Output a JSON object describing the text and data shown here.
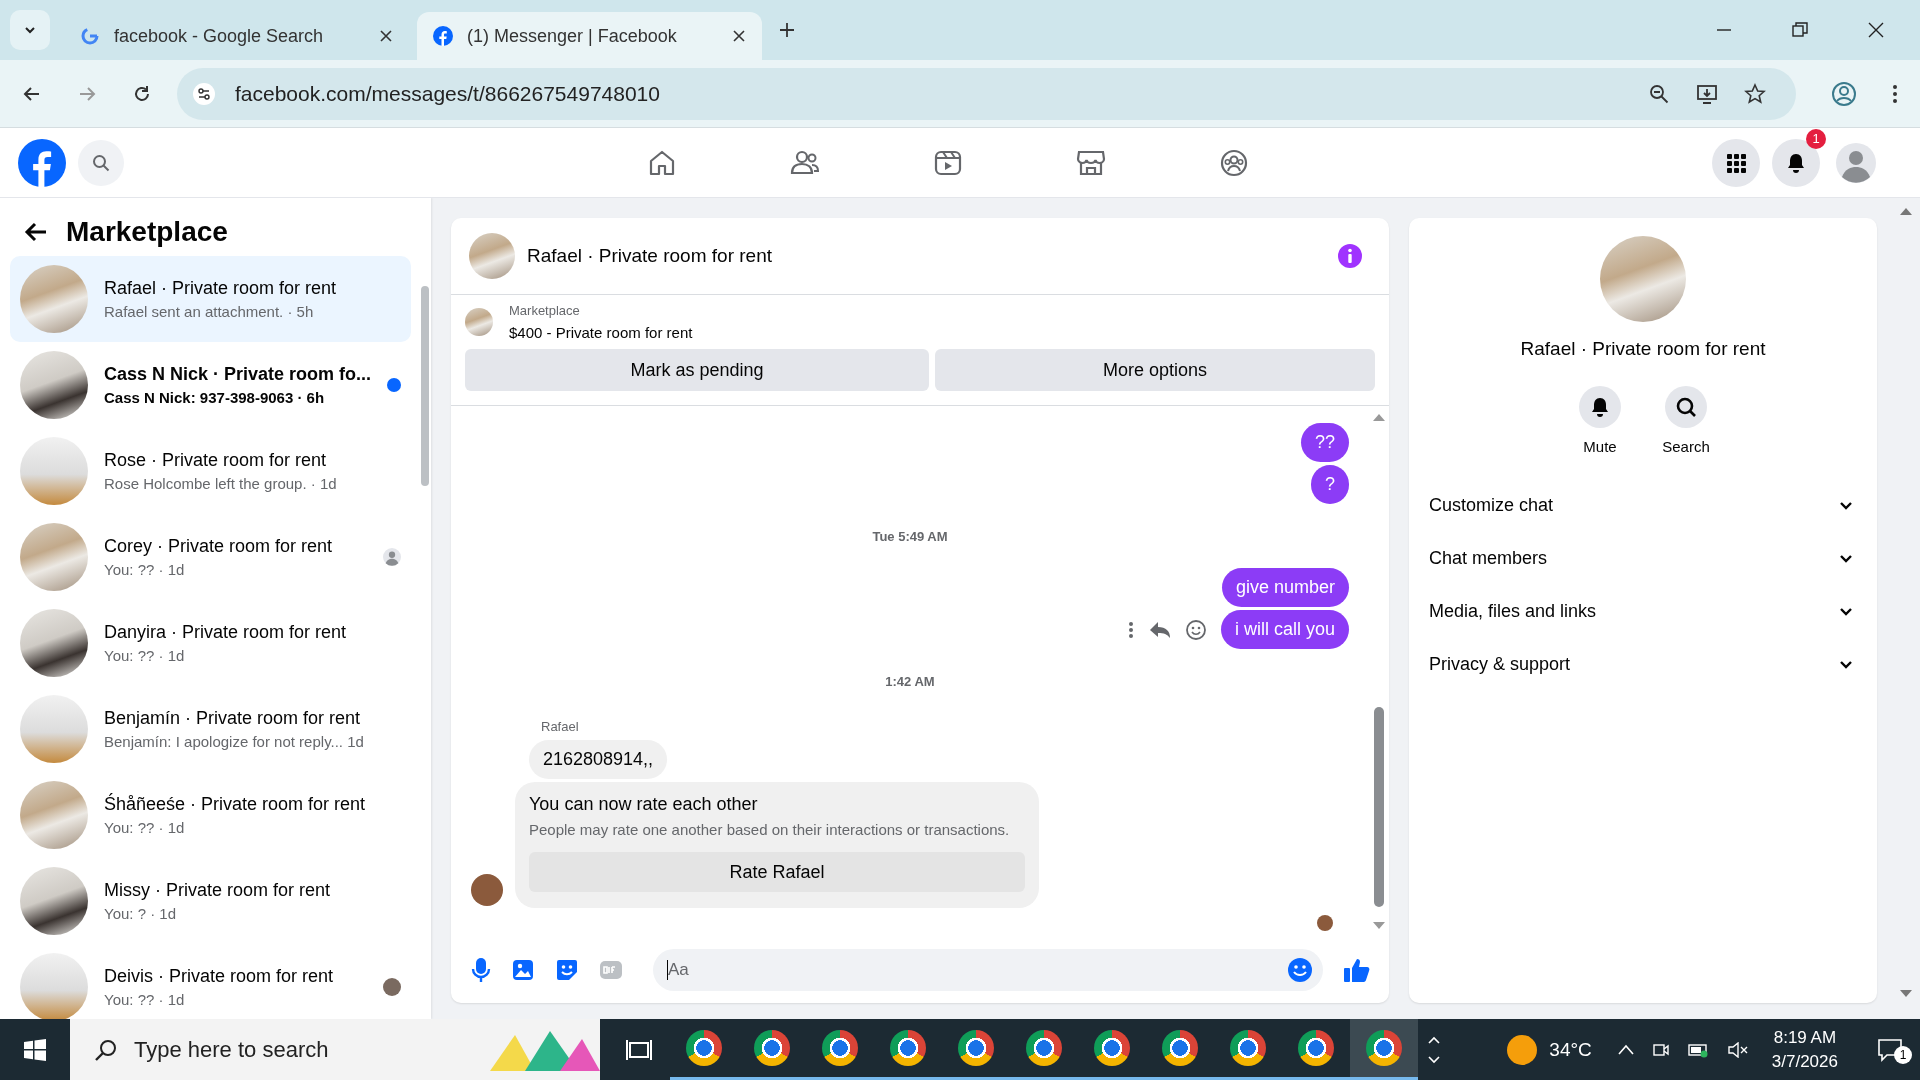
{
  "browser": {
    "tabs": [
      {
        "title": "facebook - Google Search",
        "kind": "google",
        "selected": false
      },
      {
        "title": "(1) Messenger | Facebook",
        "kind": "facebook",
        "selected": true
      }
    ],
    "url": "facebook.com/messages/t/866267549748010"
  },
  "topbar": {
    "nav": [
      {
        "kind": "home"
      },
      {
        "kind": "friends"
      },
      {
        "kind": "video"
      },
      {
        "kind": "marketplace"
      },
      {
        "kind": "groups"
      }
    ],
    "notification_count": "1"
  },
  "sidebar": {
    "title": "Marketplace",
    "chats": [
      {
        "name": "Rafael · Private room for rent",
        "subtitle": "Rafael sent an attachment. · 5h",
        "unread": false,
        "selected": true
      },
      {
        "name": "Cass N Nick · Private room fo...",
        "subtitle": "Cass N Nick: 937-398-9063 · 6h",
        "unread": true,
        "selected": false
      },
      {
        "name": "Rose · Private room for rent",
        "subtitle": "Rose Holcombe left the group. · 1d",
        "unread": false,
        "selected": false
      },
      {
        "name": "Corey · Private room for rent",
        "subtitle": "You: ?? · 1d",
        "unread": false,
        "selected": false,
        "kind": "seen_avatar"
      },
      {
        "name": "Danyira · Private room for rent",
        "subtitle": "You: ?? · 1d",
        "unread": false,
        "selected": false
      },
      {
        "name": "Benjamín · Private room for rent",
        "subtitle": "Benjamín: I apologize for not reply...  1d",
        "unread": false,
        "selected": false
      },
      {
        "name": "Śhåñeeśe · Private room for rent",
        "subtitle": "You: ?? · 1d",
        "unread": false,
        "selected": false
      },
      {
        "name": "Missy · Private room for rent",
        "subtitle": "You: ? · 1d",
        "unread": false,
        "selected": false
      },
      {
        "name": "Deivis · Private room for rent",
        "subtitle": "You: ?? · 1d",
        "unread": false,
        "selected": false,
        "kind": "seen_photo"
      }
    ]
  },
  "chat": {
    "title": "Rafael · Private room for rent",
    "listing": {
      "label": "Marketplace",
      "title": "$400 - Private room for rent"
    },
    "listing_buttons": [
      "Mark as pending",
      "More options"
    ],
    "messages": [
      {
        "kind": "outgoing",
        "text": "??"
      },
      {
        "kind": "outgoing",
        "text": "?"
      },
      {
        "kind": "timestamp",
        "text": "Tue 5:49 AM"
      },
      {
        "kind": "outgoing",
        "text": "give number"
      },
      {
        "kind": "outgoing",
        "text": "i will call you",
        "hover_actions": true
      },
      {
        "kind": "timestamp",
        "text": "1:42 AM"
      },
      {
        "kind": "sender",
        "text": "Rafael"
      },
      {
        "kind": "incoming",
        "text": "2162808914,,"
      },
      {
        "kind": "rating_card",
        "title": "You can now rate each other",
        "text": "People may rate one another based on their interactions or transactions.",
        "button": "Rate Rafael"
      }
    ],
    "seen": true,
    "composer": {
      "placeholder": "Aa"
    }
  },
  "details": {
    "title": "Rafael · Private room for rent",
    "actions": [
      {
        "kind": "mute",
        "label": "Mute"
      },
      {
        "kind": "search",
        "label": "Search"
      }
    ],
    "sections": [
      {
        "label": "Customize chat",
        "expanded": false
      },
      {
        "label": "Chat members",
        "expanded": false
      },
      {
        "label": "Media, files and links",
        "expanded": false
      },
      {
        "label": "Privacy & support",
        "expanded": false
      }
    ]
  },
  "taskbar": {
    "search_placeholder": "Type here to search",
    "apps": [
      {
        "selected": false
      },
      {
        "selected": false
      },
      {
        "selected": false
      },
      {
        "selected": false
      },
      {
        "selected": false
      },
      {
        "selected": false
      },
      {
        "selected": false
      },
      {
        "selected": false
      },
      {
        "selected": false
      },
      {
        "selected": false
      },
      {
        "selected": true
      }
    ],
    "temperature": "34°C",
    "time": "8:19 AM",
    "date": "3/7/2026",
    "notification_count": "1"
  }
}
